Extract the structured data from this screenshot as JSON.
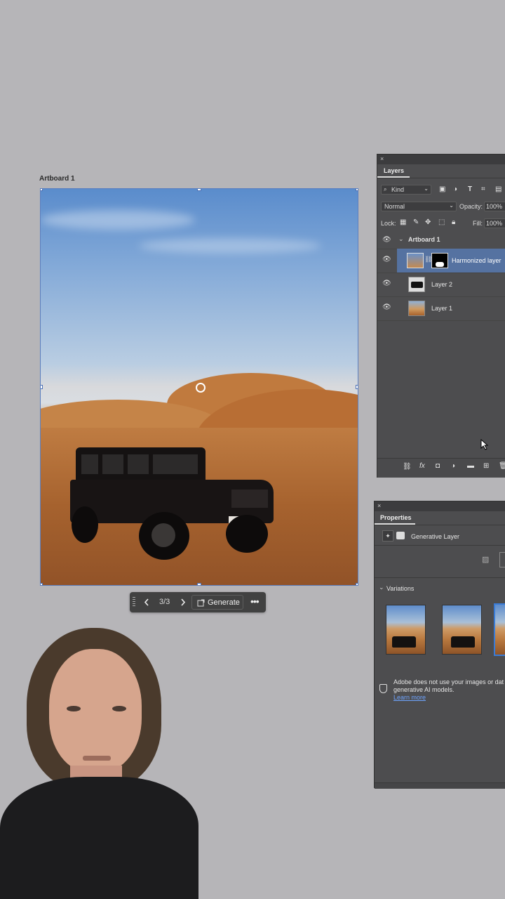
{
  "artboard": {
    "label": "Artboard 1"
  },
  "contextual_bar": {
    "prev_icon": "chevron-left-icon",
    "counter": "3/3",
    "next_icon": "chevron-right-icon",
    "generate_label": "Generate",
    "more_icon": "more-horizontal-icon"
  },
  "layers_panel": {
    "tab": "Layers",
    "filter_kind": "Kind",
    "blend_mode": "Normal",
    "opacity_label": "Opacity:",
    "opacity_value": "100%",
    "lock_label": "Lock:",
    "fill_label": "Fill:",
    "fill_value": "100%",
    "group_name": "Artboard 1",
    "layers": [
      {
        "name": "Harmonized layer",
        "selected": true
      },
      {
        "name": "Layer 2",
        "selected": false
      },
      {
        "name": "Layer 1",
        "selected": false
      }
    ]
  },
  "properties_panel": {
    "tab": "Properties",
    "layer_type": "Generative Layer",
    "variations_label": "Variations",
    "notice_text": "Adobe does not use your images or data to train generative AI models.",
    "notice_line1": "Adobe does not use your images or dat",
    "notice_line2": "generative AI models.",
    "learn_more": "Learn more"
  },
  "colors": {
    "panel_bg": "#4d4d4f",
    "selected_row": "#5572a1",
    "canvas_bg": "#b6b5b8",
    "accent": "#3a7bd5"
  }
}
